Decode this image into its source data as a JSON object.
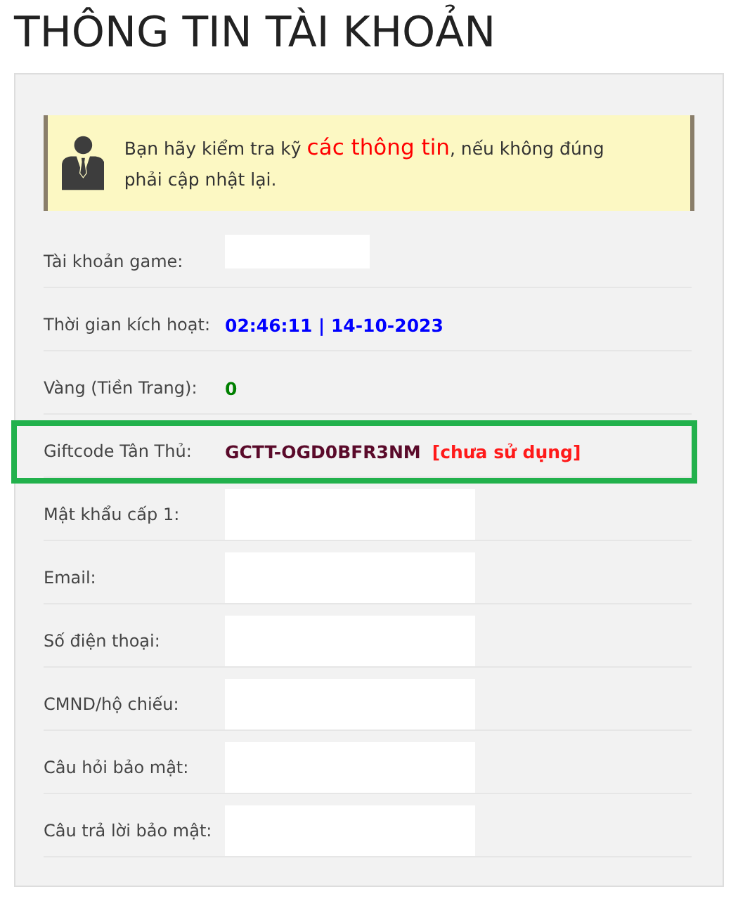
{
  "title": "THÔNG TIN TÀI KHOẢN",
  "notice": {
    "before": "Bạn hãy kiểm tra kỹ ",
    "highlight": "các thông tin",
    "after": ", nếu không đúng phải cập nhật lại."
  },
  "rows": [
    {
      "label": "Tài khoản game:",
      "kind": "redacted",
      "tall": false,
      "highlighted": false
    },
    {
      "label": "Thời gian kích hoạt:",
      "kind": "time",
      "value": "02:46:11 | 14-10-2023",
      "highlighted": false
    },
    {
      "label": "Vàng (Tiền Trang):",
      "kind": "gold",
      "value": "0",
      "highlighted": false
    },
    {
      "label": "Giftcode Tân Thủ:",
      "kind": "giftcode",
      "value": "GCTT-OGD0BFR3NM",
      "status": "[chưa sử dụng]",
      "highlighted": true
    },
    {
      "label": "Mật khẩu cấp 1:",
      "kind": "redacted",
      "tall": true,
      "highlighted": false
    },
    {
      "label": "Email:",
      "kind": "redacted",
      "tall": true,
      "highlighted": false
    },
    {
      "label": "Số điện thoại:",
      "kind": "redacted",
      "tall": true,
      "highlighted": false
    },
    {
      "label": "CMND/hộ chiếu:",
      "kind": "redacted",
      "tall": true,
      "highlighted": false
    },
    {
      "label": "Câu hỏi bảo mật:",
      "kind": "redacted",
      "tall": true,
      "highlighted": false
    },
    {
      "label": "Câu trả lời bảo mật:",
      "kind": "redacted",
      "tall": true,
      "highlighted": false
    }
  ]
}
